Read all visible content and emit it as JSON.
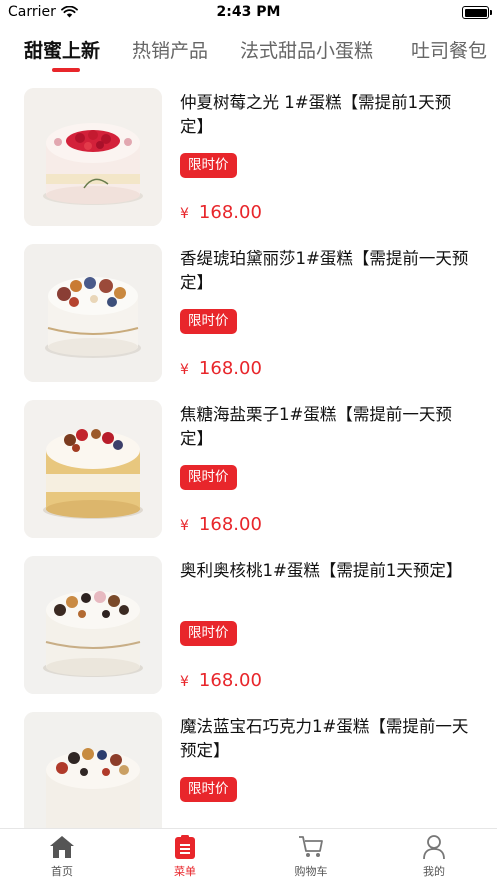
{
  "status_bar": {
    "carrier": "Carrier",
    "time": "2:43 PM"
  },
  "tabs": [
    {
      "label": "甜蜜上新",
      "active": true
    },
    {
      "label": "热销产品",
      "active": false
    },
    {
      "label": "法式甜品小蛋糕",
      "active": false
    },
    {
      "label": "吐司餐包",
      "active": false
    }
  ],
  "accent_color": "#e8262b",
  "products": [
    {
      "title": "仲夏树莓之光 1#蛋糕【需提前1天预定】",
      "badge": "限时价",
      "currency": "¥",
      "price": "168.00"
    },
    {
      "title": "香缇琥珀黛丽莎1#蛋糕【需提前一天预定】",
      "badge": "限时价",
      "currency": "¥",
      "price": "168.00"
    },
    {
      "title": "焦糖海盐栗子1#蛋糕【需提前一天预定】",
      "badge": "限时价",
      "currency": "¥",
      "price": "168.00"
    },
    {
      "title": "奥利奥核桃1#蛋糕【需提前1天预定】",
      "badge": "限时价",
      "currency": "¥",
      "price": "168.00"
    },
    {
      "title": "魔法蓝宝石巧克力1#蛋糕【需提前一天预定】",
      "badge": "限时价",
      "currency": "¥",
      "price": ""
    }
  ],
  "bottom_nav": [
    {
      "label": "首页",
      "icon": "home-icon",
      "active": false
    },
    {
      "label": "菜单",
      "icon": "menu-list-icon",
      "active": true
    },
    {
      "label": "购物车",
      "icon": "cart-icon",
      "active": false
    },
    {
      "label": "我的",
      "icon": "user-icon",
      "active": false
    }
  ]
}
